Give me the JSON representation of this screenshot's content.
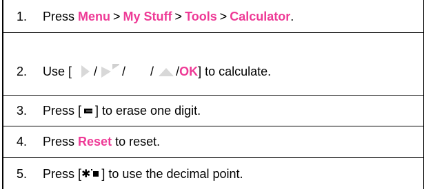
{
  "steps": [
    {
      "num": "1.",
      "press": "Press",
      "menu": "Menu",
      "gt1": ">",
      "my_stuff": "My Stuff",
      "gt2": ">",
      "tools": "Tools",
      "gt3": ">",
      "calculator": "Calculator",
      "end": "."
    },
    {
      "num": "2.",
      "use": "Use [",
      "slash1": "/",
      "slash2": "/",
      "slash3": "/",
      "slash4": "/",
      "ok": "OK",
      "end": "] to calculate."
    },
    {
      "num": "3.",
      "press": "Press [",
      "end": "] to erase one digit."
    },
    {
      "num": "4.",
      "press": "Press",
      "reset": "Reset",
      "end": "to reset."
    },
    {
      "num": "5.",
      "press": "Press [",
      "end": "] to use the decimal point."
    }
  ],
  "icons": {
    "nav_up": "nav-up-icon",
    "nav_down": "nav-down-icon",
    "nav_left": "nav-left-icon",
    "nav_right": "nav-right-icon",
    "clear": "clear-key-icon",
    "star": "star-key-icon"
  },
  "colors": {
    "highlight": "#ee3a96",
    "navkey": "#d8d8d8"
  }
}
